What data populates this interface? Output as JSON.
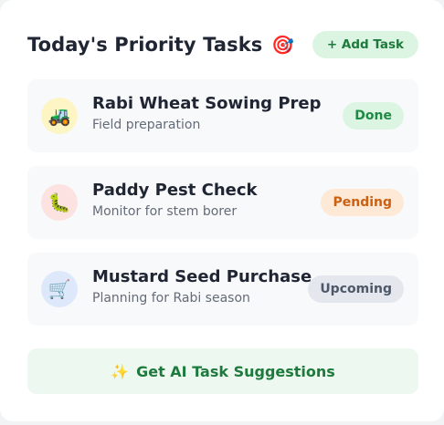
{
  "header": {
    "title": "Today's Priority Tasks",
    "title_icon": "🎯",
    "add_button_label": "+ Add Task"
  },
  "tasks": [
    {
      "icon": "🚜",
      "icon_name": "tractor-icon",
      "icon_bg": "#fdf6c4",
      "title": "Rabi Wheat Sowing Prep",
      "subtitle": "Field preparation",
      "status": "Done",
      "status_color": "#1e8a44"
    },
    {
      "icon": "🐛",
      "icon_name": "caterpillar-icon",
      "icon_bg": "#fde2e2",
      "title": "Paddy Pest Check",
      "subtitle": "Monitor for stem borer",
      "status": "Pending",
      "status_color": "#cc6010"
    },
    {
      "icon": "🛒",
      "icon_name": "shopping-cart-icon",
      "icon_bg": "#dde9fb",
      "title": "Mustard Seed Purchase",
      "subtitle": "Planning for Rabi season",
      "status": "Upcoming",
      "status_color": "#4d5869"
    }
  ],
  "suggestions": {
    "icon": "✨",
    "label": "Get AI Task Suggestions"
  },
  "colors": {
    "accent_green": "#1e7a3c",
    "card_bg": "#ffffff"
  }
}
